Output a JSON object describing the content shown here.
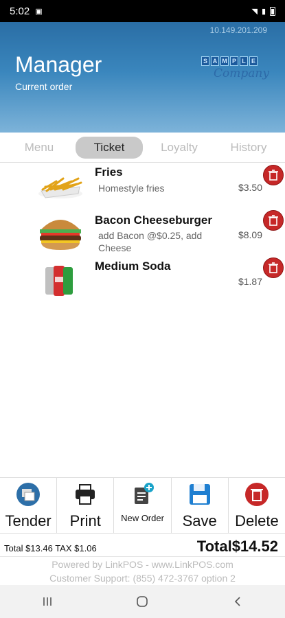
{
  "status": {
    "time": "5:02"
  },
  "header": {
    "ip": "10.149.201.209",
    "title": "Manager",
    "subtitle": "Current order",
    "logo_letters": [
      "S",
      "A",
      "M",
      "P",
      "L",
      "E"
    ],
    "logo_script": "Company"
  },
  "tabs": [
    {
      "label": "Menu"
    },
    {
      "label": "Ticket"
    },
    {
      "label": "Loyalty"
    },
    {
      "label": "History"
    }
  ],
  "items": [
    {
      "name": "Fries",
      "desc": "Homestyle fries",
      "price": "$3.50",
      "icon": "fries-image"
    },
    {
      "name": "Bacon Cheeseburger",
      "desc": "add Bacon @$0.25, add Cheese",
      "price": "$8.09",
      "icon": "burger-image"
    },
    {
      "name": "Medium Soda",
      "desc": "",
      "price": "$1.87",
      "icon": "soda-cans-image"
    }
  ],
  "actions": {
    "tender": "Tender",
    "print": "Print",
    "new_order": "New Order",
    "save": "Save",
    "delete": "Delete"
  },
  "totals": {
    "subtotal_line": "Total $13.46 TAX $1.06",
    "grand": "Total$14.52"
  },
  "footer": {
    "line1": "Powered by LinkPOS - www.LinkPOS.com",
    "line2": "Customer Support: (855) 472-3767 option 2"
  },
  "colors": {
    "accent": "#2a6ea5",
    "delete_red": "#c62828",
    "save_blue": "#1f7fd1"
  }
}
